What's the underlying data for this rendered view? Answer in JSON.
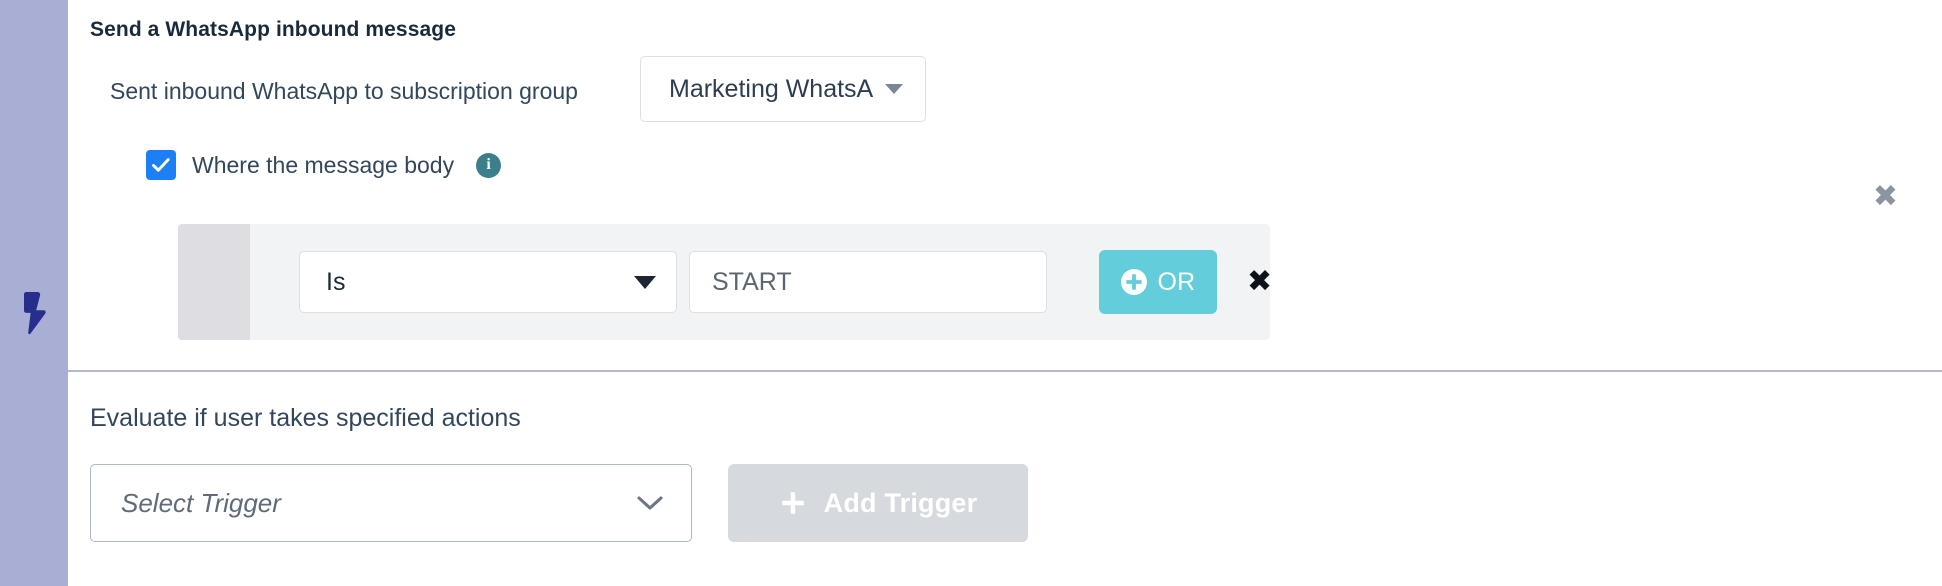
{
  "colors": {
    "rail_background": "#a9aed5",
    "rail_icon": "#26308c",
    "checkbox_accent": "#1d7ff5",
    "info_icon": "#3b7f8c",
    "or_button": "#63cddb",
    "condition_panel": "#f2f3f5",
    "condition_handle": "#dddde2",
    "add_trigger_disabled": "#d6dade",
    "heading_text": "#192a3d",
    "body_text": "#33475b",
    "remove_icon_gray": "#8b95a1",
    "remove_icon_dark": "#0c1217"
  },
  "rail": {
    "icon": "lightning-bolt-icon"
  },
  "trigger_section": {
    "title": "Send a WhatsApp inbound message",
    "subscription": {
      "label": "Sent inbound WhatsApp to subscription group",
      "selected_value": "Marketing WhatsA...",
      "caret_icon": "caret-down-icon"
    },
    "filter": {
      "checkbox_checked": true,
      "checkbox_icon": "checkmark-icon",
      "label": "Where the message body",
      "info_icon": "info-icon",
      "info_icon_glyph": "i"
    },
    "group_remove_icon": "close-icon",
    "group_remove_glyph": "✖",
    "condition": {
      "drag_handle_icon": "drag-handle",
      "operator_value": "Is",
      "operator_caret_icon": "caret-down-icon",
      "value_text": "START",
      "value_placeholder": "START",
      "or_button_label": "OR",
      "or_button_icon": "plus-circle-icon",
      "remove_icon": "close-icon",
      "remove_glyph": "✖"
    }
  },
  "actions_section": {
    "title": "Evaluate if user takes specified actions",
    "trigger_select": {
      "placeholder": "Select Trigger",
      "chevron_icon": "chevron-down-icon"
    },
    "add_trigger": {
      "label": "Add Trigger",
      "icon": "plus-icon",
      "disabled": true
    }
  }
}
